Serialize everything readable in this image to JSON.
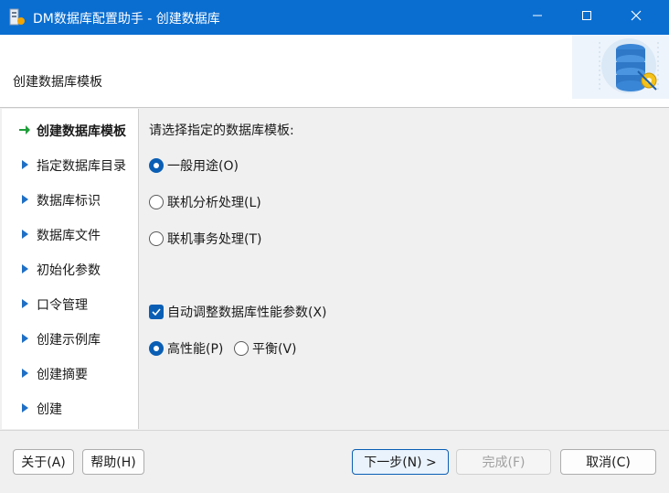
{
  "window": {
    "title": "DM数据库配置助手 - 创建数据库",
    "controls": [
      "minimize-icon",
      "maximize-icon",
      "close-icon"
    ]
  },
  "header": {
    "title": "创建数据库模板",
    "art": "database-gear-icon"
  },
  "sidebar": {
    "items": [
      {
        "label": "创建数据库模板",
        "icon": "green-arrow-icon",
        "active": true
      },
      {
        "label": "指定数据库目录",
        "icon": "triangle-right-icon",
        "active": false
      },
      {
        "label": "数据库标识",
        "icon": "triangle-right-icon",
        "active": false
      },
      {
        "label": "数据库文件",
        "icon": "triangle-right-icon",
        "active": false
      },
      {
        "label": "初始化参数",
        "icon": "triangle-right-icon",
        "active": false
      },
      {
        "label": "口令管理",
        "icon": "triangle-right-icon",
        "active": false
      },
      {
        "label": "创建示例库",
        "icon": "triangle-right-icon",
        "active": false
      },
      {
        "label": "创建摘要",
        "icon": "triangle-right-icon",
        "active": false
      },
      {
        "label": "创建",
        "icon": "triangle-right-icon",
        "active": false
      }
    ]
  },
  "main": {
    "prompt": "请选择指定的数据库模板:",
    "templates": [
      {
        "label": "一般用途(O)",
        "selected": true
      },
      {
        "label": "联机分析处理(L)",
        "selected": false
      },
      {
        "label": "联机事务处理(T)",
        "selected": false
      }
    ],
    "auto_tune": {
      "label": "自动调整数据库性能参数(X)",
      "checked": true
    },
    "performance": [
      {
        "label": "高性能(P)",
        "selected": true
      },
      {
        "label": "平衡(V)",
        "selected": false
      }
    ]
  },
  "footer": {
    "about": "关于(A)",
    "help": "帮助(H)",
    "next": "下一步(N) >",
    "finish": "完成(F)",
    "cancel": "取消(C)"
  },
  "colors": {
    "titlebar": "#0a6ed1",
    "accent": "#0a5fb4",
    "nav_triangle": "#1f6fc5",
    "active_arrow": "#1e9e3a"
  }
}
